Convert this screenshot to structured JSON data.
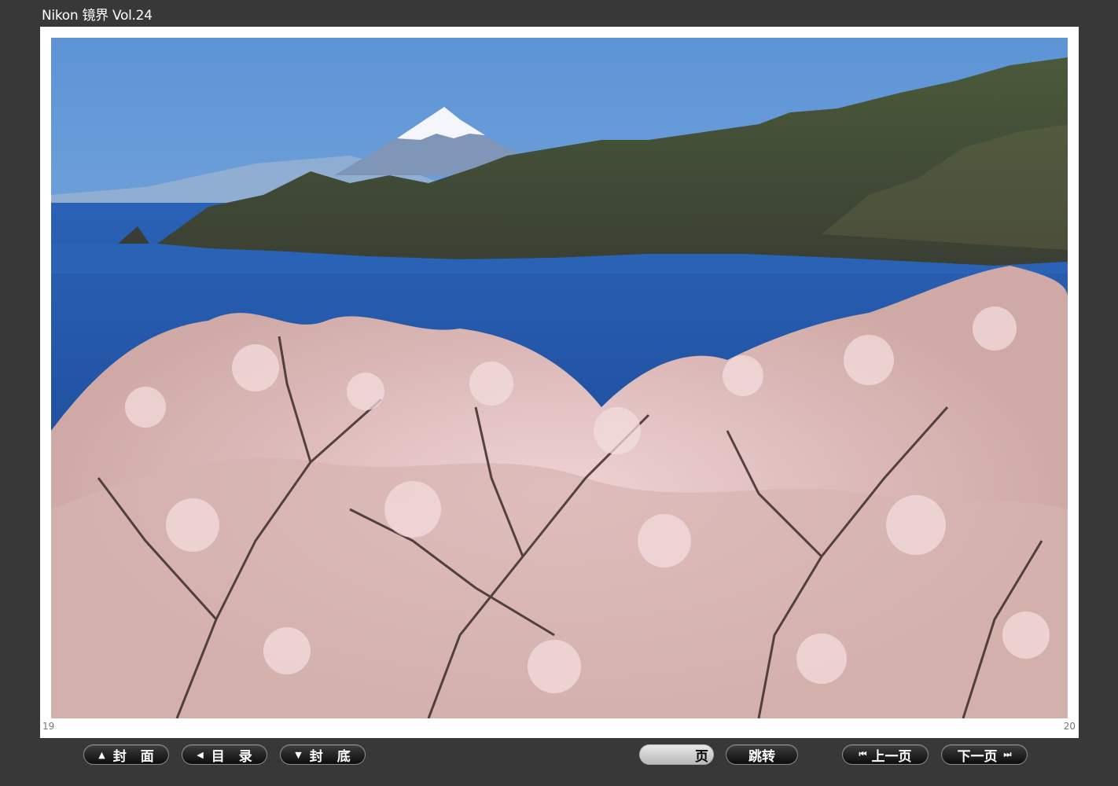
{
  "window": {
    "title": "Nikon 镜界 Vol.24"
  },
  "spread": {
    "left_page": "19",
    "right_page": "20"
  },
  "toolbar": {
    "cover_label": "封面",
    "toc_label": "目录",
    "back_cover_label": "封底",
    "page_value": "",
    "page_suffix": "页",
    "jump_label": "跳转",
    "prev_label": "上一页",
    "next_label": "下一页"
  },
  "icons": {
    "cover": "up-triangle-icon",
    "toc": "left-triangle-icon",
    "back_cover": "down-triangle-icon",
    "prev": "skip-back-icon",
    "next": "skip-forward-icon"
  }
}
